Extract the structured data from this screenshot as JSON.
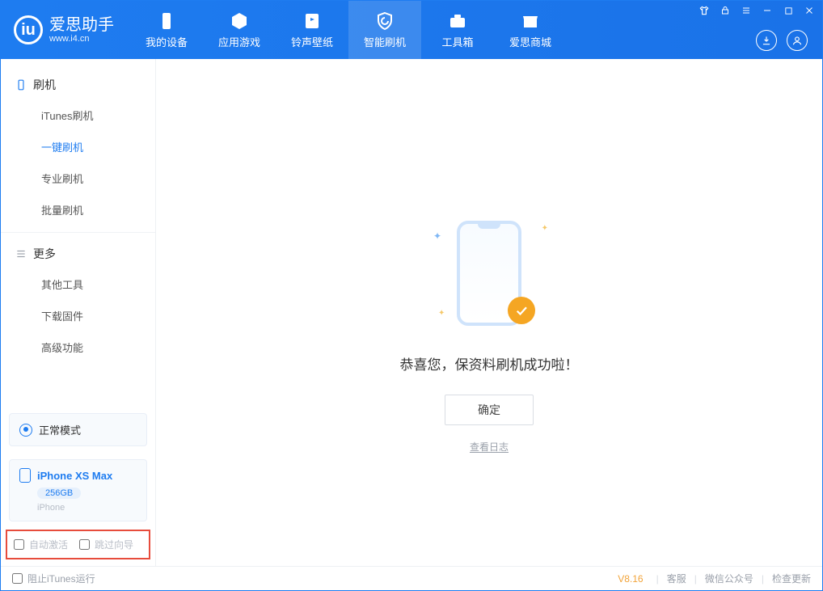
{
  "app": {
    "name_cn": "爱思助手",
    "url": "www.i4.cn"
  },
  "header_tabs": [
    {
      "label": "我的设备"
    },
    {
      "label": "应用游戏"
    },
    {
      "label": "铃声壁纸"
    },
    {
      "label": "智能刷机"
    },
    {
      "label": "工具箱"
    },
    {
      "label": "爱思商城"
    }
  ],
  "sidebar": {
    "group1": {
      "title": "刷机",
      "items": [
        "iTunes刷机",
        "一键刷机",
        "专业刷机",
        "批量刷机"
      ],
      "active_index": 1
    },
    "group2": {
      "title": "更多",
      "items": [
        "其他工具",
        "下载固件",
        "高级功能"
      ]
    }
  },
  "device": {
    "mode_label": "正常模式",
    "name": "iPhone XS Max",
    "capacity": "256GB",
    "subtitle": "iPhone"
  },
  "options": {
    "auto_activate_label": "自动激活",
    "skip_guide_label": "跳过向导"
  },
  "main": {
    "success_message": "恭喜您，保资料刷机成功啦！",
    "ok_button": "确定",
    "view_log": "查看日志"
  },
  "footer": {
    "block_itunes_label": "阻止iTunes运行",
    "version": "V8.16",
    "links": [
      "客服",
      "微信公众号",
      "检查更新"
    ]
  }
}
